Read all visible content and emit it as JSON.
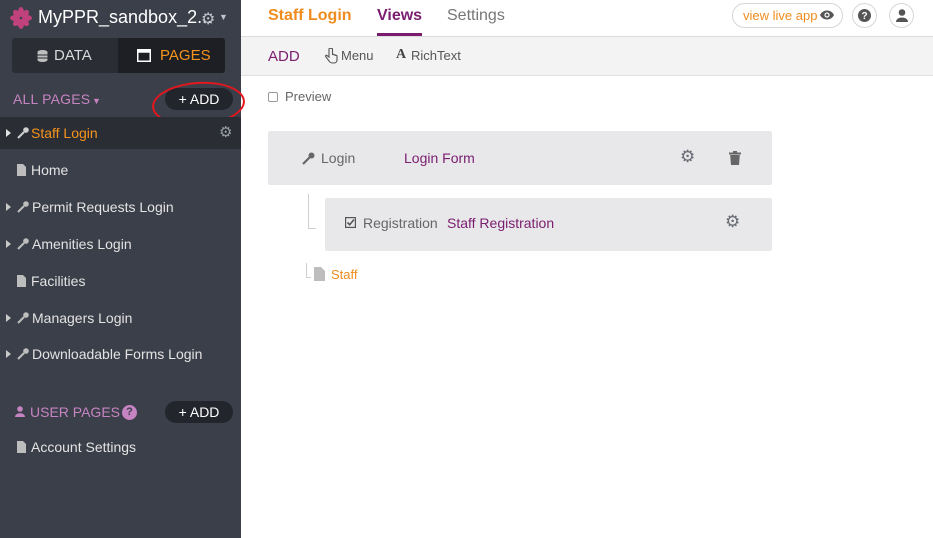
{
  "app": {
    "title": "MyPPR_sandbox_2...",
    "logo_color": "#c0427c"
  },
  "mode_tabs": [
    {
      "label": "DATA",
      "icon": "database-icon",
      "active": false
    },
    {
      "label": "PAGES",
      "icon": "window-icon",
      "active": true
    }
  ],
  "sidebar": {
    "all_pages_label": "ALL PAGES",
    "add_label": "+ ADD",
    "pages": [
      {
        "label": "Staff Login",
        "icon": "key-icon",
        "expandable": true,
        "active": true
      },
      {
        "label": "Home",
        "icon": "document-icon",
        "expandable": false,
        "active": false
      },
      {
        "label": "Permit Requests Login",
        "icon": "key-icon",
        "expandable": true,
        "active": false
      },
      {
        "label": "Amenities Login",
        "icon": "key-icon",
        "expandable": true,
        "active": false
      },
      {
        "label": "Facilities",
        "icon": "document-icon",
        "expandable": false,
        "active": false
      },
      {
        "label": "Managers Login",
        "icon": "key-icon",
        "expandable": true,
        "active": false
      },
      {
        "label": "Downloadable Forms Login",
        "icon": "key-icon",
        "expandable": true,
        "active": false
      }
    ],
    "user_pages_label": "USER PAGES",
    "user_add_label": "+ ADD",
    "user_pages": [
      {
        "label": "Account Settings",
        "icon": "document-icon"
      }
    ]
  },
  "topnav": {
    "page_name": "Staff Login",
    "tabs": [
      {
        "label": "Views",
        "active": true
      },
      {
        "label": "Settings",
        "active": false
      }
    ],
    "view_live_label": "view live app"
  },
  "toolbar": {
    "add_label": "ADD",
    "menu_label": "Menu",
    "richtext_label": "RichText"
  },
  "main": {
    "preview_label": "Preview",
    "preview_checked": false,
    "views": [
      {
        "type": "Login",
        "name": "Login Form",
        "icon": "key-icon"
      },
      {
        "type": "Registration",
        "name": "Staff Registration",
        "icon": "checkbox-icon"
      }
    ],
    "child_page": "Staff"
  },
  "colors": {
    "accent_orange": "#f08c1f",
    "accent_purple": "#7a1d6e",
    "sidebar_bg": "#3b3f49",
    "annotation_red": "#e4161e"
  }
}
